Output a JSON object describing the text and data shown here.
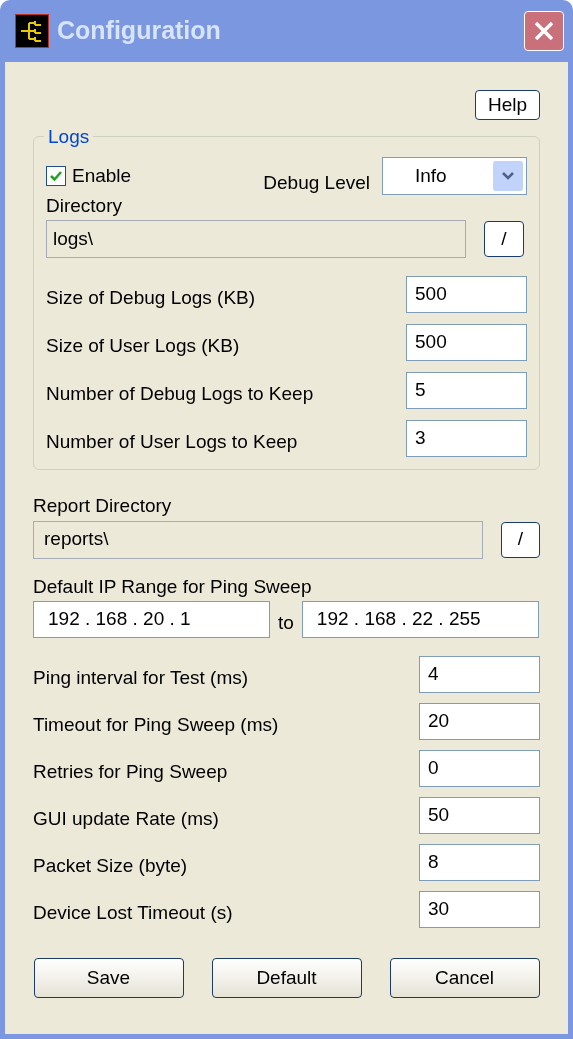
{
  "window": {
    "title": "Configuration"
  },
  "help_button": "Help",
  "logs": {
    "title": "Logs",
    "enable": {
      "label": "Enable",
      "checked": true
    },
    "debug_level": {
      "label": "Debug Level",
      "value": "Info"
    },
    "directory": {
      "label": "Directory",
      "value": "logs\\",
      "browse": "/"
    },
    "fields": [
      {
        "label": "Size of Debug Logs (KB)",
        "value": "500"
      },
      {
        "label": "Size of User Logs (KB)",
        "value": "500"
      },
      {
        "label": "Number of Debug Logs to Keep",
        "value": "5"
      },
      {
        "label": "Number of User Logs to Keep",
        "value": "3"
      }
    ]
  },
  "report_directory": {
    "label": "Report Directory",
    "value": "reports\\",
    "browse": "/"
  },
  "ip_range": {
    "label": "Default IP Range for Ping Sweep",
    "from": "192 . 168 . 20 . 1",
    "separator": "to",
    "to": "192 . 168 . 22 . 255"
  },
  "fields": [
    {
      "label": "Ping interval for Test (ms)",
      "value": "4"
    },
    {
      "label": "Timeout for Ping Sweep (ms)",
      "value": "20"
    },
    {
      "label": "Retries for Ping Sweep",
      "value": "0"
    },
    {
      "label": "GUI update Rate (ms)",
      "value": "50"
    },
    {
      "label": "Packet Size (byte)",
      "value": "8"
    },
    {
      "label": "Device Lost Timeout (s)",
      "value": "30"
    }
  ],
  "buttons": [
    "Save",
    "Default",
    "Cancel"
  ]
}
